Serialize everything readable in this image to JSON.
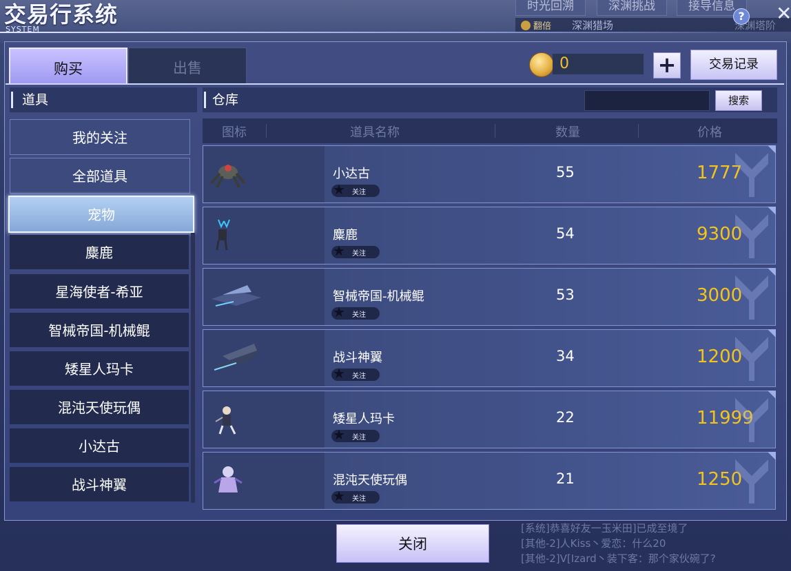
{
  "window": {
    "title": "交易行系统",
    "subtitle": "SYSTEM",
    "help_label": "?",
    "close_label": "✕"
  },
  "background": {
    "top_tabs": [
      "时光回溯",
      "深渊挑战",
      "接导信息"
    ],
    "strip": {
      "double_label": "翻倍",
      "hunt_label": "深渊猎场",
      "tower_label": "深渊塔阶"
    },
    "chat": [
      "[系统]恭喜好友一玉米田]已成至境了",
      "[其他-2]人Kiss丶爱恋：什么20",
      "[其他-2]V[Izard丶装下客：那个家伙碗了?"
    ]
  },
  "tabs": {
    "buy": "购买",
    "sell": "出售"
  },
  "currency": {
    "value": "0",
    "plus_label": "+",
    "record_label": "交易记录"
  },
  "left_header": "道具",
  "right_header": "仓库",
  "search": {
    "button_label": "搜索",
    "value": ""
  },
  "categories": [
    {
      "label": "我的关注",
      "style": "top"
    },
    {
      "label": "全部道具",
      "style": "top"
    },
    {
      "label": "宠物",
      "style": "active"
    },
    {
      "label": "麋鹿",
      "style": "sub"
    },
    {
      "label": "星海使者-希亚",
      "style": "sub"
    },
    {
      "label": "智械帝国-机械鲲",
      "style": "sub"
    },
    {
      "label": "矮星人玛卡",
      "style": "sub"
    },
    {
      "label": "混沌天使玩偶",
      "style": "sub"
    },
    {
      "label": "小达古",
      "style": "sub"
    },
    {
      "label": "战斗神翼",
      "style": "sub"
    }
  ],
  "table": {
    "columns": [
      "图标",
      "道具名称",
      "数量",
      "价格"
    ],
    "follow_label": "关注",
    "rows": [
      {
        "icon": "spider-mech-icon",
        "name": "小达古",
        "qty": "55",
        "price": "1777"
      },
      {
        "icon": "deer-icon",
        "name": "麋鹿",
        "qty": "54",
        "price": "9300"
      },
      {
        "icon": "mech-whale-icon",
        "name": "智械帝国-机械鲲",
        "qty": "53",
        "price": "3000"
      },
      {
        "icon": "battle-wing-icon",
        "name": "战斗神翼",
        "qty": "34",
        "price": "1200"
      },
      {
        "icon": "dwarf-maka-icon",
        "name": "矮星人玛卡",
        "qty": "22",
        "price": "11999"
      },
      {
        "icon": "chaos-angel-doll-icon",
        "name": "混沌天使玩偶",
        "qty": "21",
        "price": "1250"
      }
    ]
  },
  "close_button": "关闭",
  "colors": {
    "price": "#f3c41c",
    "accent": "#c9c2ff",
    "panel": "#36427a"
  }
}
